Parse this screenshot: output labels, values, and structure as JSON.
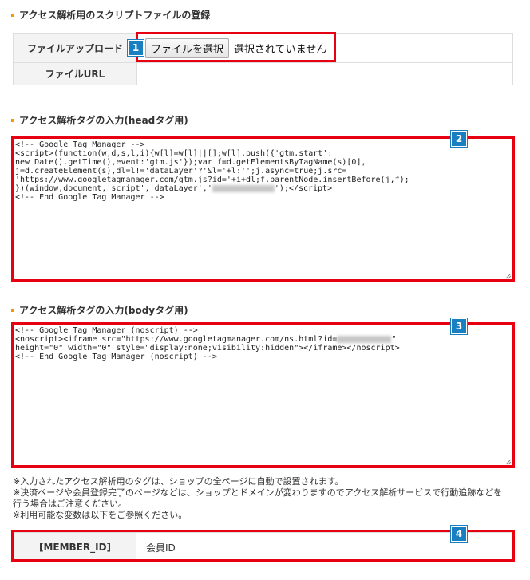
{
  "upload_section": {
    "title": "アクセス解析用のスクリプトファイルの登録",
    "file_upload_label": "ファイルアップロード",
    "file_button_label": "ファイルを選択",
    "file_status": "選択されていません",
    "file_url_label": "ファイルURL",
    "file_url_value": ""
  },
  "head_section": {
    "title": "アクセス解析タグの入力(headタグ用)",
    "code_lines": [
      "<!-- Google Tag Manager -->",
      "<script>(function(w,d,s,l,i){w[l]=w[l]||[];w[l].push({'gtm.start':",
      "new Date().getTime(),event:'gtm.js'});var f=d.getElementsByTagName(s)[0],",
      "j=d.createElement(s),dl=l!='dataLayer'?'&l='+l:'';j.async=true;j.src=",
      "'https://www.googletagmanager.com/gtm.js?id='+i+dl;f.parentNode.insertBefore(j,f);",
      "})(window,document,'script','dataLayer','",
      "');</script>",
      "<!-- End Google Tag Manager -->"
    ]
  },
  "body_section": {
    "title": "アクセス解析タグの入力(bodyタグ用)",
    "code_lines": [
      "<!-- Google Tag Manager (noscript) -->",
      "<noscript><iframe src=\"https://www.googletagmanager.com/ns.html?id=",
      "\"",
      "height=\"0\" width=\"0\" style=\"display:none;visibility:hidden\"></iframe></noscript>",
      "<!-- End Google Tag Manager (noscript) -->"
    ]
  },
  "notes": [
    "※入力されたアクセス解析用のタグは、ショップの全ページに自動で設置されます。",
    "※決済ページや会員登録完了のページなどは、ショップとドメインが変わりますのでアクセス解析サービスで行動追跡などを",
    "行う場合はご注意ください。",
    "※利用可能な変数は以下をご参照ください。"
  ],
  "variables": [
    {
      "name": "[MEMBER_ID]",
      "desc": "会員ID"
    }
  ],
  "badges": [
    "1",
    "2",
    "3",
    "4"
  ],
  "colors": {
    "highlight": "#e60012",
    "badge": "#1a7fc1",
    "bullet": "#f39800",
    "header_bg": "#f3f3f3"
  }
}
